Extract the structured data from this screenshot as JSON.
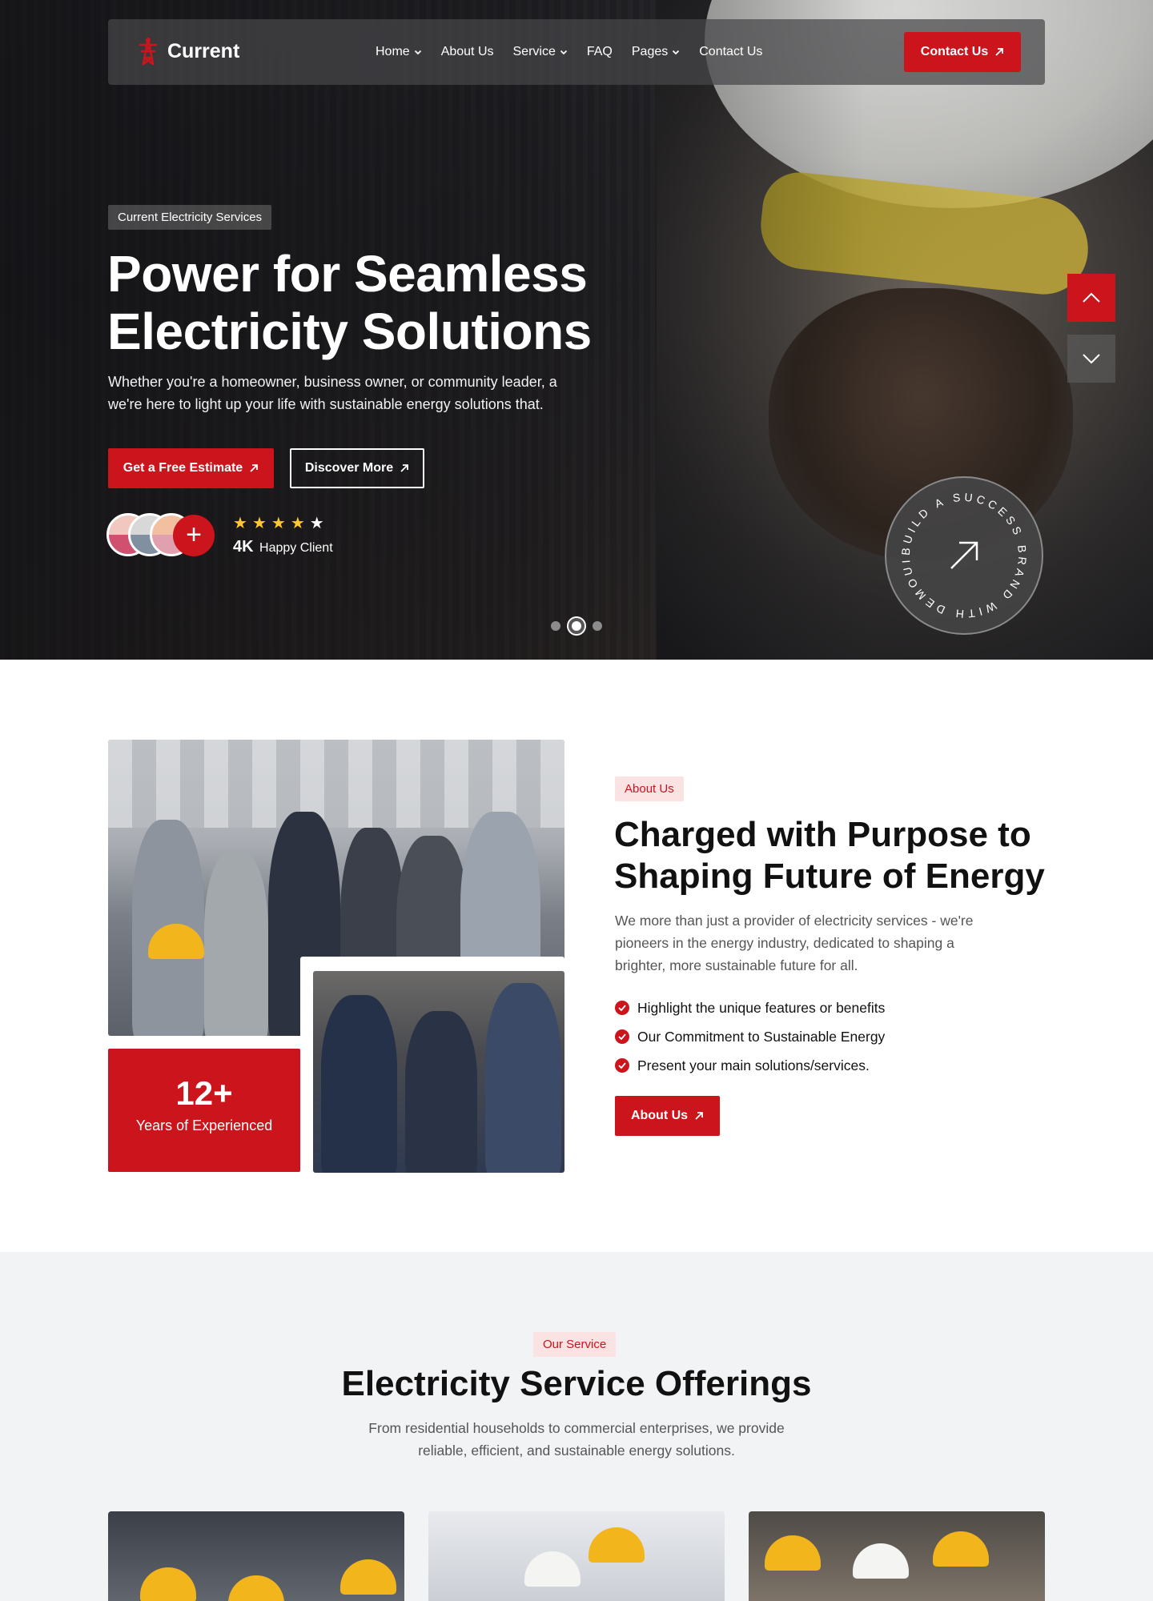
{
  "brand": {
    "name": "Current",
    "accent": "#cc141d"
  },
  "nav": {
    "items": [
      {
        "label": "Home",
        "has_dropdown": true
      },
      {
        "label": "About Us",
        "has_dropdown": false
      },
      {
        "label": "Service",
        "has_dropdown": true
      },
      {
        "label": "FAQ",
        "has_dropdown": false
      },
      {
        "label": "Pages",
        "has_dropdown": true
      },
      {
        "label": "Contact Us",
        "has_dropdown": false
      }
    ],
    "cta_label": "Contact Us"
  },
  "hero": {
    "tag": "Current Electricity Services",
    "title_line1": "Power for Seamless",
    "title_line2": "Electricity Solutions",
    "desc_line1": "Whether you're a homeowner, business owner, or community leader, a",
    "desc_line2": "we're here to light up your life with sustainable energy solutions that.",
    "primary_button": "Get a Free Estimate",
    "secondary_button": "Discover More",
    "rating_stars": 5,
    "clients_count": "4K",
    "clients_label": "Happy Client",
    "badge_text": "BUILD A SUCCESS BRAND WITH DEMOUI",
    "slides": 3,
    "active_slide": 2,
    "plus_glyph": "+"
  },
  "about": {
    "tag": "About Us",
    "title_line1": "Charged with Purpose to",
    "title_line2": "Shaping Future of Energy",
    "desc_line1": "We more than just a provider of electricity services - we're",
    "desc_line2": "pioneers in the energy industry, dedicated to shaping a",
    "desc_line3": "brighter, more sustainable future for all.",
    "checks": [
      "Highlight the unique features or benefits",
      "Our Commitment to Sustainable Energy",
      "Present your main solutions/services."
    ],
    "button": "About Us",
    "experience_value": "12+",
    "experience_label": "Years of Experienced"
  },
  "services": {
    "tag": "Our Service",
    "title": "Electricity Service Offerings",
    "desc_line1": "From residential households to commercial enterprises, we provide",
    "desc_line2": "reliable, efficient, and sustainable energy solutions."
  }
}
